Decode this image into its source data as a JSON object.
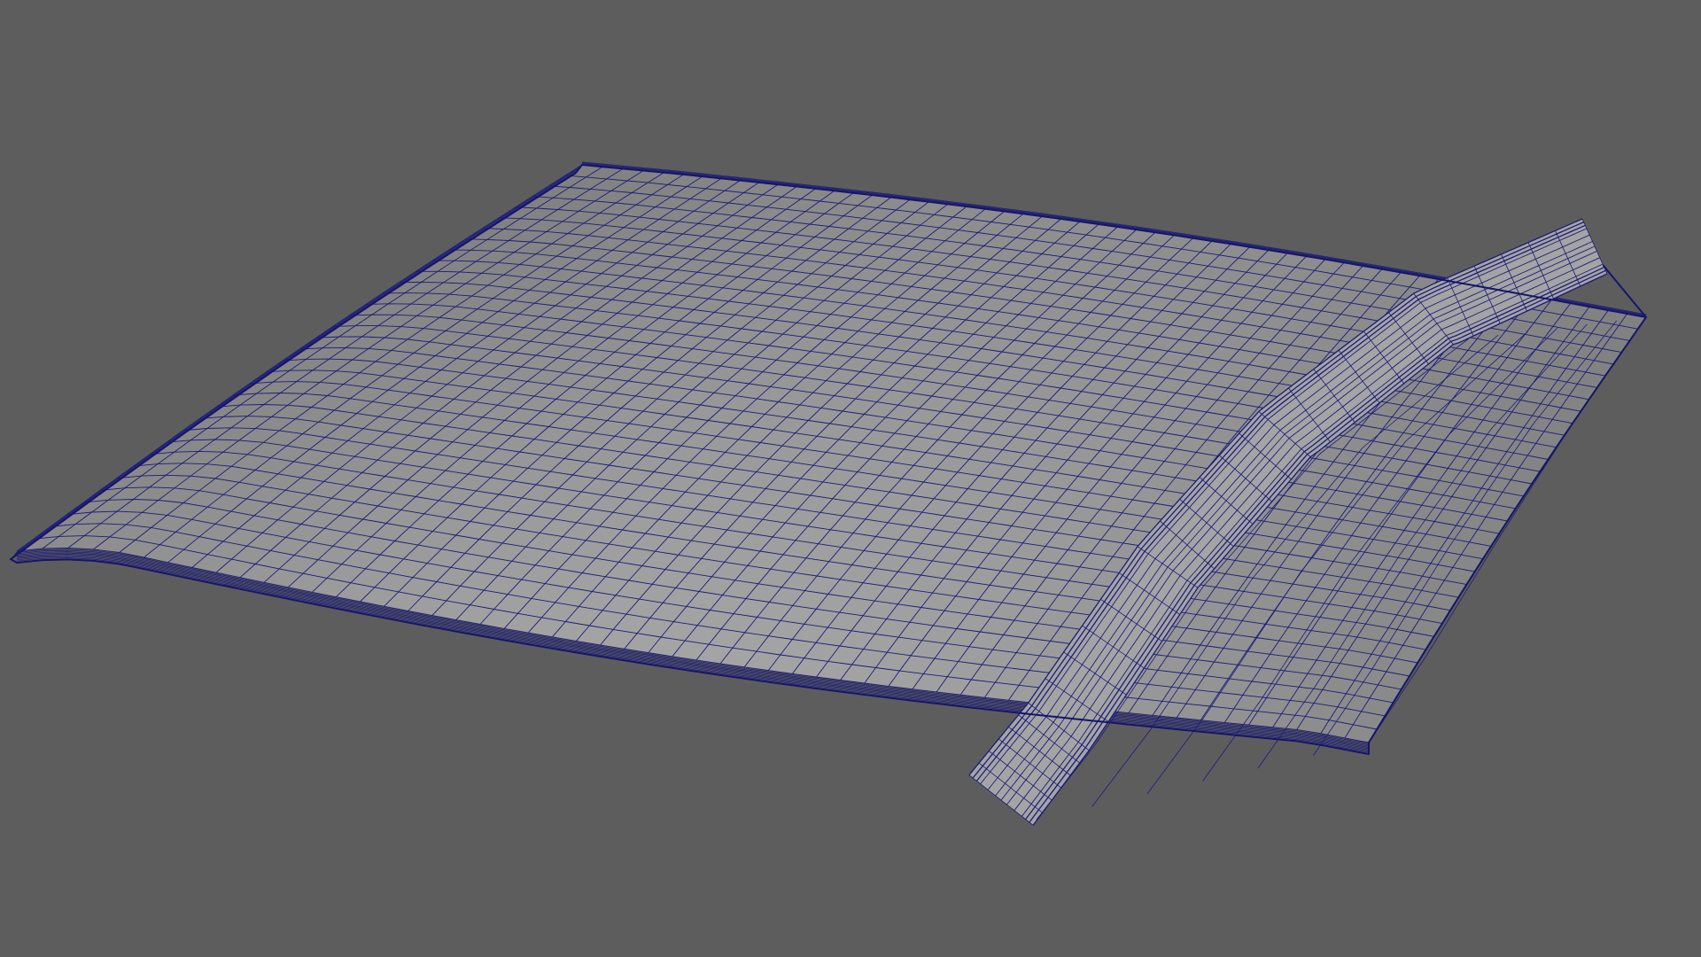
{
  "viewport": {
    "background_color": "#5d5d5d"
  },
  "mesh": {
    "object": "car-hood-mesh",
    "display_mode": "wireframe-on-shaded",
    "surface_color": "#9d9d9d",
    "wire_color": "#1c1c7a",
    "outline_color": "#15156a"
  }
}
